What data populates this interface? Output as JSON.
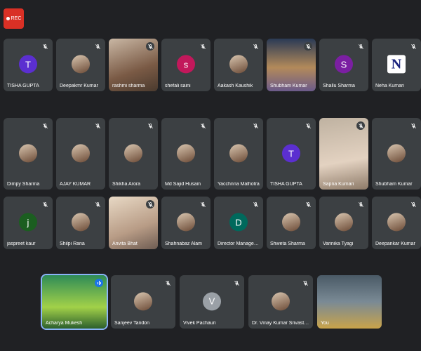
{
  "recording": {
    "label": "REC"
  },
  "participants": [
    {
      "name": "TISHA GUPTA",
      "avatar": "initial",
      "initial": "T",
      "color": "#5b2fd0"
    },
    {
      "name": "Deepakmr Kumar",
      "avatar": "photo"
    },
    {
      "name": "rashmi sharma",
      "avatar": "video"
    },
    {
      "name": "shefali saini",
      "avatar": "initial",
      "initial": "s",
      "color": "#c2185b"
    },
    {
      "name": "Aakash Kaushik",
      "avatar": "photo"
    },
    {
      "name": "Shubham Kumar",
      "avatar": "video"
    },
    {
      "name": "Shallu Sharma",
      "avatar": "initial",
      "initial": "S",
      "color": "#7b1fa2"
    },
    {
      "name": "Neha Kumari",
      "avatar": "logo",
      "initial": "N",
      "color": "#ffffff"
    },
    {
      "name": "Dimpy Sharma",
      "avatar": "photo"
    },
    {
      "name": "AJAY KUMAR",
      "avatar": "photo"
    },
    {
      "name": "Shikha Arora",
      "avatar": "photo"
    },
    {
      "name": "Md Sajid Husain",
      "avatar": "photo"
    },
    {
      "name": "Yacchnna Malhotra",
      "avatar": "photo"
    },
    {
      "name": "TISHA GUPTA",
      "avatar": "initial",
      "initial": "T",
      "color": "#5b2fd0"
    },
    {
      "name": "Sapna Kumari",
      "avatar": "video"
    },
    {
      "name": "Shubham Kumar",
      "avatar": "photo"
    },
    {
      "name": "jaspreet kaur",
      "avatar": "initial",
      "initial": "j",
      "color": "#1b5e20"
    },
    {
      "name": "Shilpi Rana",
      "avatar": "photo"
    },
    {
      "name": "Anvita Bhat",
      "avatar": "video"
    },
    {
      "name": "Shahnabaz Alam",
      "avatar": "photo"
    },
    {
      "name": "Director Management...",
      "avatar": "initial",
      "initial": "D",
      "color": "#00695c"
    },
    {
      "name": "Shweta Sharma",
      "avatar": "photo"
    },
    {
      "name": "Varinika Tyagi",
      "avatar": "photo"
    },
    {
      "name": "Deepankar Kumar",
      "avatar": "photo"
    },
    {
      "name": "Acharya Mukesh",
      "avatar": "video",
      "active": true
    },
    {
      "name": "Sanjeev Tandon",
      "avatar": "photo"
    },
    {
      "name": "Vivek Pachauri",
      "avatar": "initial",
      "initial": "V",
      "color": "#9aa0a6"
    },
    {
      "name": "Dr. Vinay Kumar Srivastava",
      "avatar": "photo"
    },
    {
      "name": "You",
      "avatar": "video"
    }
  ],
  "colors": {
    "background": "#202124",
    "tile": "#3c4043",
    "rec": "#d93025",
    "active": "#8ab4f8"
  }
}
